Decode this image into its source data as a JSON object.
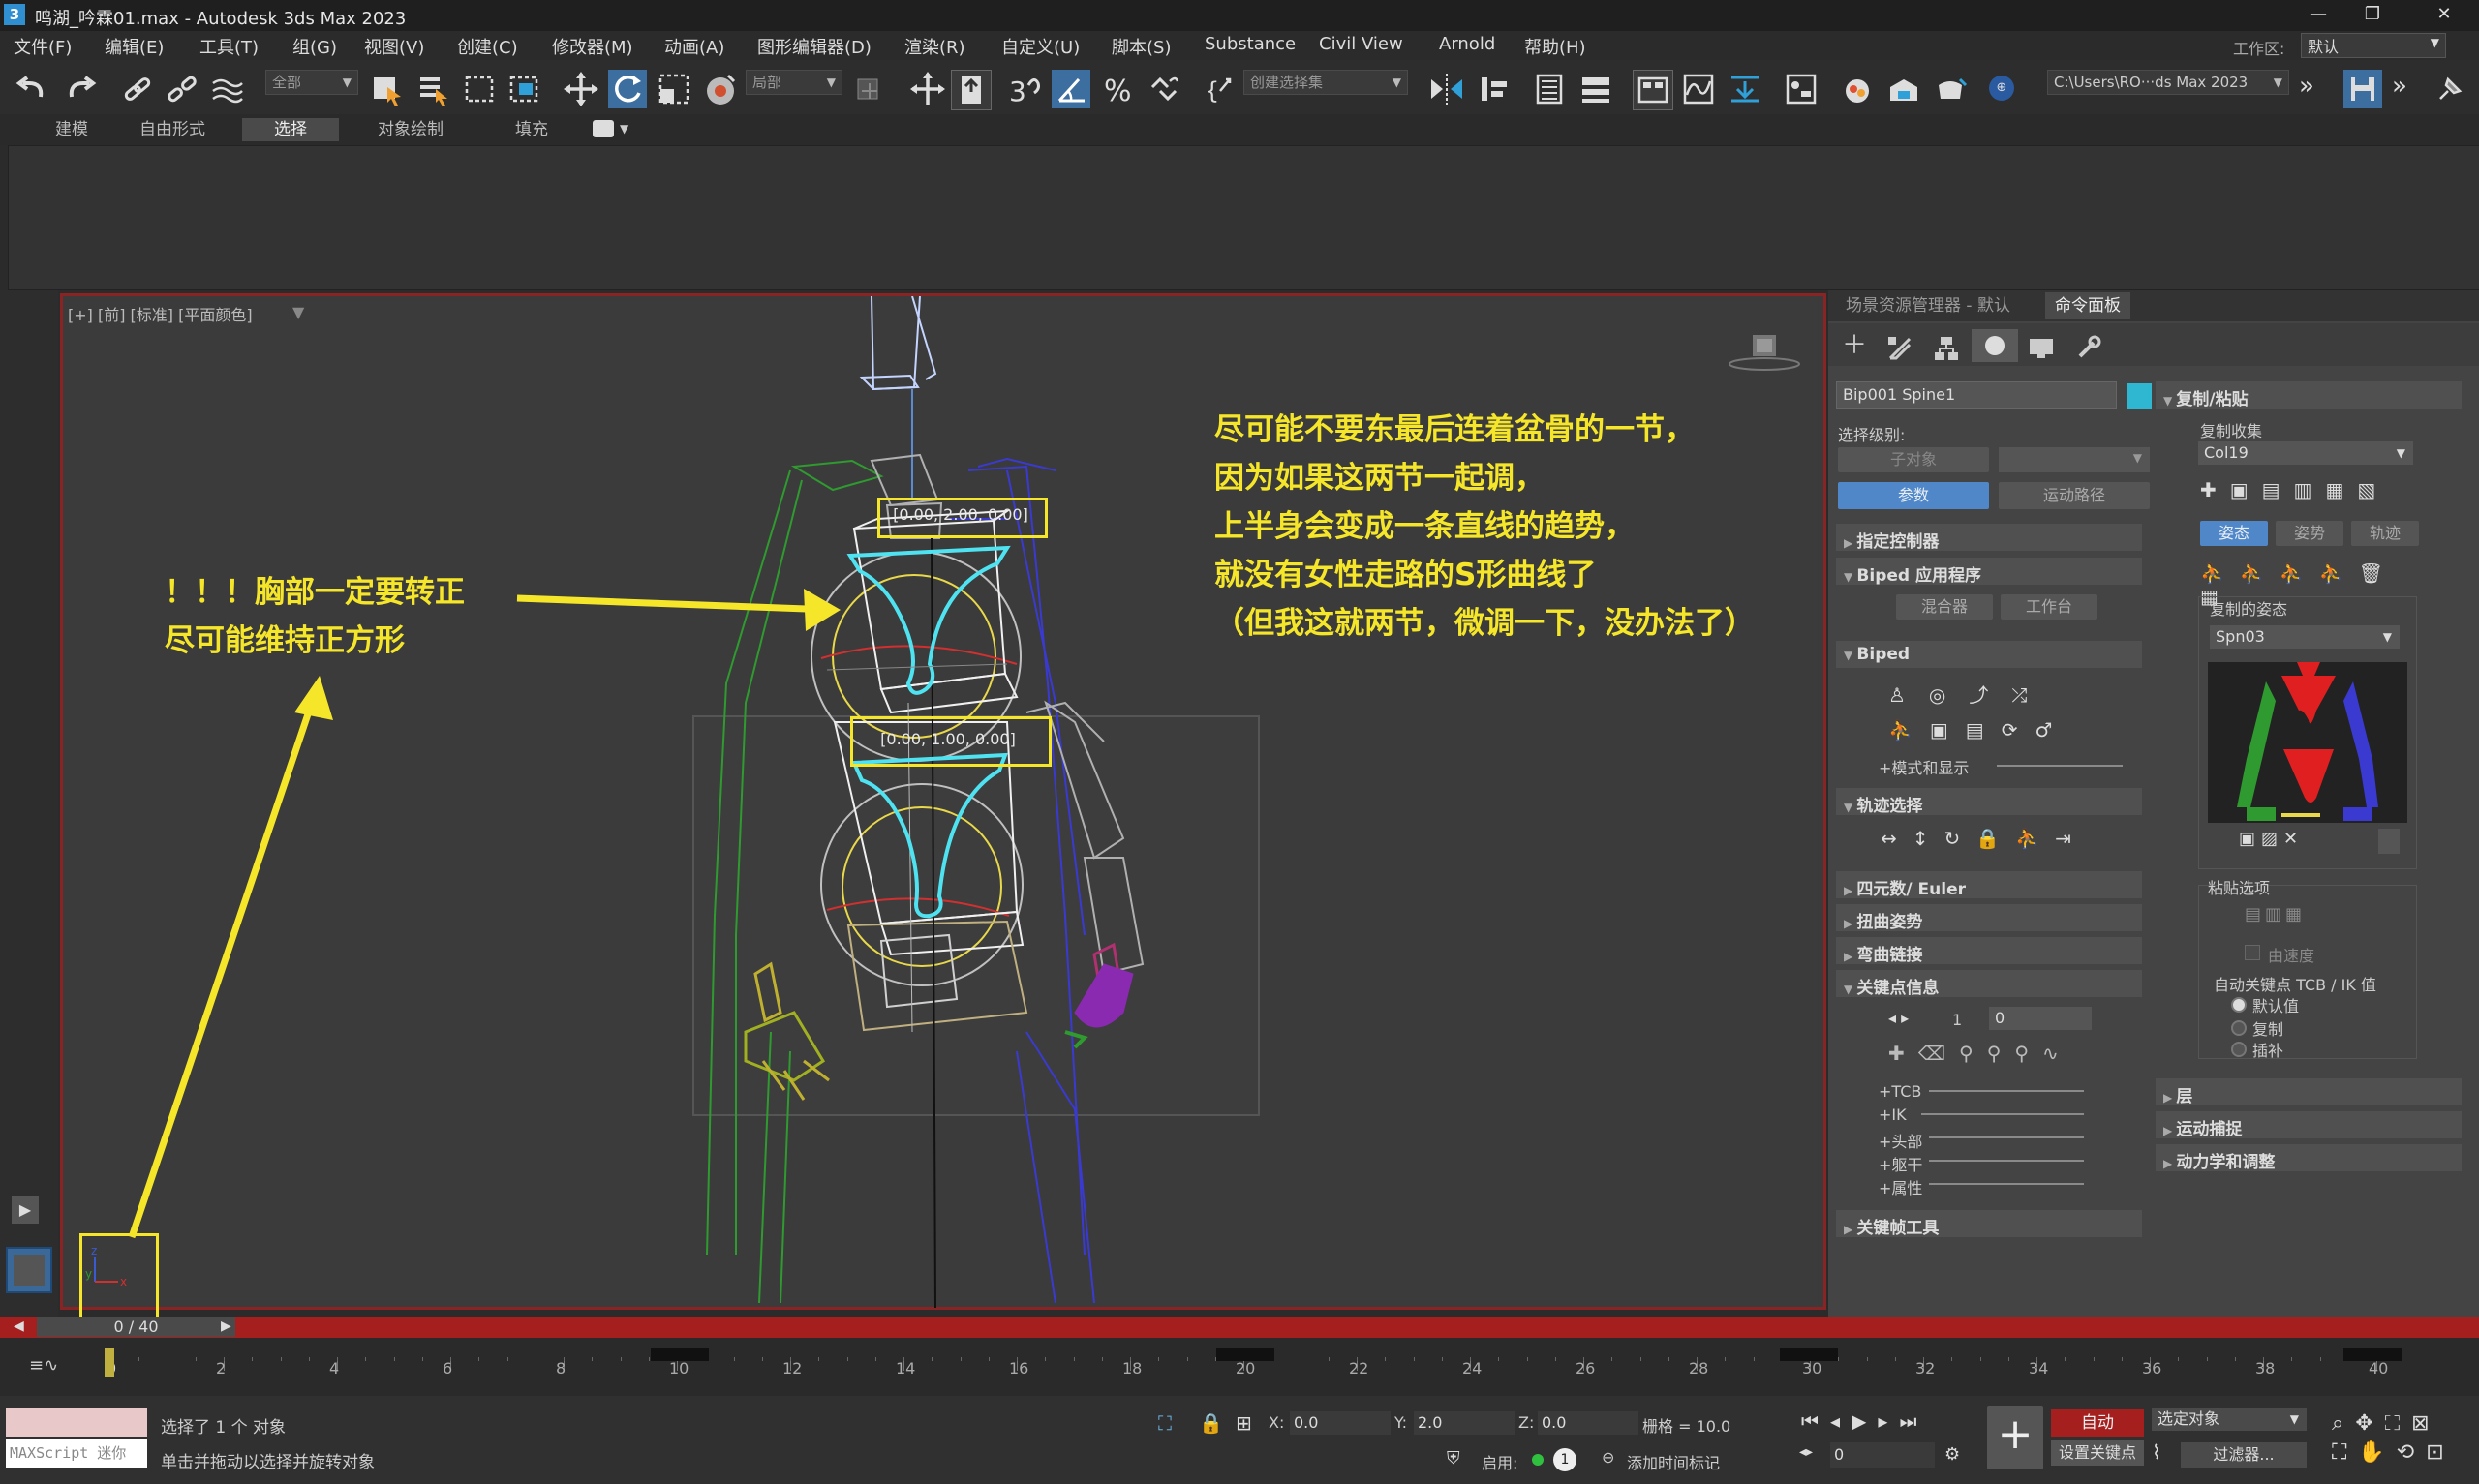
{
  "titlebar": {
    "app_icon": "3",
    "title": "鸣湖_吟霖01.max - Autodesk 3ds Max 2023",
    "minimize_icon": "minimize-icon",
    "restore_icon": "restore-icon",
    "close_icon": "close-icon"
  },
  "menubar": {
    "items": [
      "文件(F)",
      "编辑(E)",
      "工具(T)",
      "组(G)",
      "视图(V)",
      "创建(C)",
      "修改器(M)",
      "动画(A)",
      "图形编辑器(D)",
      "渲染(R)",
      "自定义(U)",
      "脚本(S)",
      "Substance",
      "Civil View",
      "Arnold",
      "帮助(H)"
    ],
    "workspace_label": "工作区:",
    "workspace_value": "默认"
  },
  "toolbar": {
    "filter_value": "全部",
    "coord_value": "局部",
    "selection_set_placeholder": "创建选择集",
    "path_value": "C:\\Users\\RO···ds Max 2023"
  },
  "ribbon": {
    "tabs": [
      "建模",
      "自由形式",
      "选择",
      "对象绘制",
      "填充"
    ],
    "active_tab": "选择"
  },
  "viewport": {
    "label": "[+] [前] [标准] [平面颜色]",
    "top_box": "[0.00, 2.00, 0.00]",
    "mid_box": "[0.00, 1.00, 0.00]"
  },
  "annotations": {
    "left_line1": "！！！胸部一定要转正",
    "left_line2": "尽可能维持正方形",
    "right_line1": "尽可能不要东最后连着盆骨的一节，",
    "right_line2": "因为如果这两节一起调，",
    "right_line3": "上半身会变成一条直线的趋势，",
    "right_line4": "就没有女性走路的S形曲线了",
    "right_line5": "（但我这就两节，微调一下，没办法了）"
  },
  "right_panel": {
    "tabs": [
      "场景资源管理器 - 默认",
      "命令面板"
    ],
    "object_name": "Bip001 Spine1",
    "selection_level_label": "选择级别:",
    "sub_object_btn": "子对象",
    "params_btn": "参数",
    "motion_path_btn": "运动路径",
    "sections": [
      "指定控制器",
      "Biped 应用程序",
      "Biped",
      "轨迹选择",
      "四元数/ Euler",
      "扭曲姿势",
      "弯曲链接",
      "关键点信息",
      "关键帧工具"
    ],
    "mixer_btn": "混合器",
    "workbench_btn": "工作台",
    "mode_display": "+模式和显示",
    "key_index": "1",
    "key_value": "0",
    "key_subs": [
      "+TCB",
      "+IK",
      "+头部",
      "+躯干",
      "+属性"
    ],
    "copy_paste_title": "复制/粘贴",
    "copy_collection_label": "复制收集",
    "copy_collection_value": "Col19",
    "posture_tabs": [
      "姿态",
      "姿势",
      "轨迹"
    ],
    "copied_pose_label": "复制的姿态",
    "copied_pose_value": "Spn03",
    "paste_options_label": "粘贴选项",
    "by_velocity": "由速度",
    "auto_key_label": "自动关键点 TCB / IK 值",
    "radio_options": [
      "默认值",
      "复制",
      "插补"
    ],
    "bottom_sections": [
      "层",
      "运动捕捉",
      "动力学和调整"
    ]
  },
  "timeline": {
    "slider_text": "0 / 40",
    "tick_labels": [
      "0",
      "2",
      "4",
      "6",
      "8",
      "10",
      "12",
      "14",
      "16",
      "18",
      "20",
      "22",
      "24",
      "26",
      "28",
      "30",
      "32",
      "34",
      "36",
      "38",
      "40"
    ]
  },
  "status": {
    "maxscript": "MAXScript 迷你",
    "selected_text": "选择了 1 个 对象",
    "hint_text": "单击并拖动以选择并旋转对象",
    "x_label": "X:",
    "x_value": "0.0",
    "y_label": "Y:",
    "y_value": "2.0",
    "z_label": "Z:",
    "z_value": "0.0",
    "grid_text": "栅格 = 10.0",
    "enable_label": "启用:",
    "add_time_tag": "添加时间标记",
    "auto_btn": "自动",
    "set_key_btn": "设置关键点",
    "selected_obj_dd": "选定对象",
    "filter_btn": "过滤器...",
    "frame_value": "0"
  },
  "colors": {
    "accent_blue": "#4f87c8",
    "timeline_red": "#a51f1f",
    "annotation_yellow": "#f6e629",
    "viewport_border": "#8a2424",
    "bone_cyan": "#4fe3f2"
  }
}
